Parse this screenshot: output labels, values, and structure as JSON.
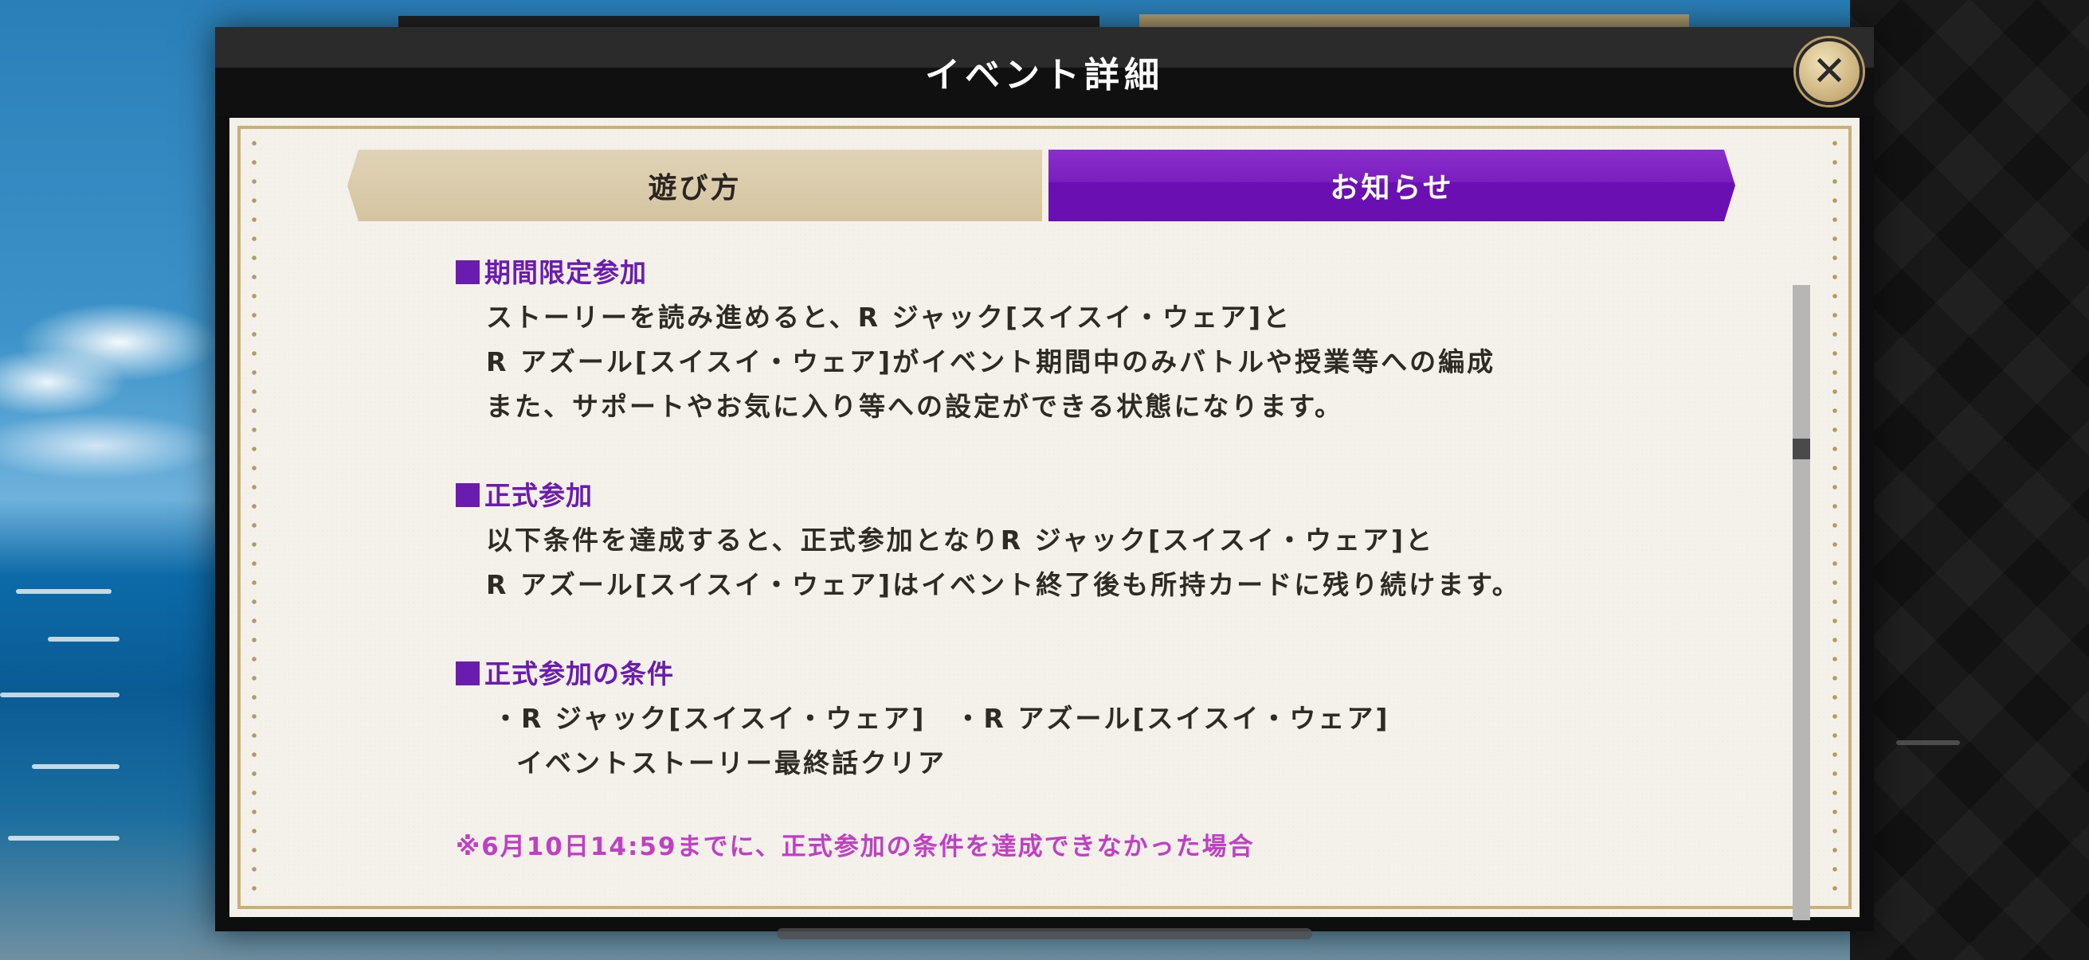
{
  "modal": {
    "title": "イベント詳細",
    "close_label": "✕"
  },
  "tabs": [
    {
      "label": "遊び方",
      "active": false
    },
    {
      "label": "お知らせ",
      "active": true
    }
  ],
  "content": {
    "sections": [
      {
        "title": "期間限定参加",
        "lines": [
          "ストーリーを読み進めると、R ジャック[スイスイ・ウェア]と",
          "R アズール[スイスイ・ウェア]がイベント期間中のみバトルや授業等への編成",
          "また、サポートやお気に入り等への設定ができる状態になります。"
        ]
      },
      {
        "title": "正式参加",
        "lines": [
          "以下条件を達成すると、正式参加となりR ジャック[スイスイ・ウェア]と",
          "R アズール[スイスイ・ウェア]はイベント終了後も所持カードに残り続けます。"
        ]
      },
      {
        "title": "正式参加の条件",
        "lines": [
          "・R ジャック[スイスイ・ウェア]　・R アズール[スイスイ・ウェア]",
          "イベントストーリー最終話クリア"
        ]
      }
    ],
    "note": "※6月10日14:59までに、正式参加の条件を達成できなかった場合"
  },
  "scrollbar": {
    "position_fraction": 0.25
  },
  "colors": {
    "accent_purple": "#6a1bb0",
    "tab_active": "#7a1fbf",
    "note_pink": "#c13fc4",
    "gold": "#c8b07a"
  }
}
